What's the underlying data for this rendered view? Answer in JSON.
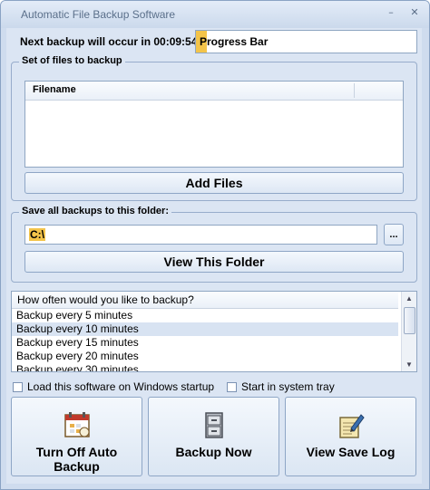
{
  "window": {
    "title": "Automatic File Backup Software",
    "controls": {
      "minimize": "–",
      "close": "✕"
    }
  },
  "schedule": {
    "next_backup_text": "Next backup will occur in 00:09:54",
    "progress_label": "Progress Bar",
    "progress_fraction": 0.05,
    "progress_color": "#f3c44a"
  },
  "files_group": {
    "legend": "Set of files to backup",
    "column_header": "Filename",
    "rows": [],
    "add_button": "Add Files"
  },
  "folder_group": {
    "legend": "Save all backups to this folder:",
    "path_value": "C:\\",
    "browse_button": "...",
    "view_button": "View This Folder"
  },
  "frequency": {
    "header": "How often would you like to backup?",
    "options": [
      "Backup every 5 minutes",
      "Backup every 10 minutes",
      "Backup every 15 minutes",
      "Backup every 20 minutes",
      "Backup every 30 minutes"
    ],
    "selected_index": 1
  },
  "options": {
    "startup_label": "Load this software on Windows startup",
    "startup_checked": false,
    "tray_label": "Start in system tray",
    "tray_checked": false
  },
  "actions": {
    "turn_off": {
      "label": "Turn Off Auto Backup",
      "icon": "schedule-icon"
    },
    "backup_now": {
      "label": "Backup Now",
      "icon": "file-cabinet-icon"
    },
    "view_log": {
      "label": "View Save Log",
      "icon": "notepad-pen-icon"
    }
  },
  "colors": {
    "window_bg": "#dbe5f3",
    "accent_highlight": "#f3c44a",
    "selection": "#d8e3f2"
  }
}
